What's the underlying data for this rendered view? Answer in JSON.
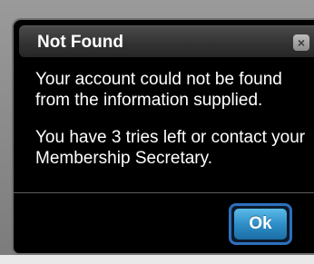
{
  "dialog": {
    "title": "Not Found",
    "close_glyph": "×",
    "close_icon": "close-icon",
    "message_line1": "Your account could not be found from the information supplied.",
    "message_line2": "You have 3 tries left or contact your Membership Secretary.",
    "ok_label": "Ok"
  },
  "colors": {
    "dialog_background": "#000000",
    "titlebar": "#333333",
    "ok_button": "#2f8ec8",
    "ok_border": "#2d6fbe",
    "text": "#ffffff"
  }
}
